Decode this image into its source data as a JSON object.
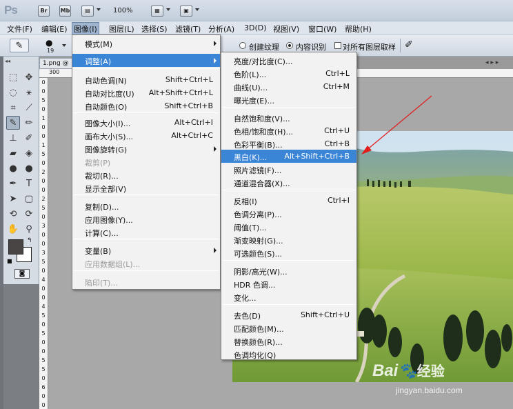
{
  "titlebar": {
    "logo": "Ps",
    "btn_br": "Br",
    "btn_mb": "Mb",
    "zoom": "100%"
  },
  "menubar": [
    "文件(F)",
    "编辑(E)",
    "图像(I)",
    "图层(L)",
    "选择(S)",
    "滤镜(T)",
    "分析(A)",
    "3D(D)",
    "视图(V)",
    "窗口(W)",
    "帮助(H)"
  ],
  "options": {
    "brush_size": "19",
    "create_texture": "创建纹理",
    "content_aware": "内容识别",
    "sample_all_layers": "对所有图层取样"
  },
  "document": {
    "tab_label": "1.png @"
  },
  "ruler": {
    "h_first": "300",
    "v_marks": [
      "0",
      "0",
      "5",
      "0",
      "1",
      "0",
      "0",
      "1",
      "5",
      "0",
      "2",
      "0",
      "0",
      "2",
      "5",
      "0",
      "3",
      "0",
      "0",
      "3",
      "5",
      "0",
      "4",
      "0",
      "0",
      "4",
      "5",
      "0",
      "5",
      "0",
      "0",
      "5",
      "5",
      "0",
      "6",
      "0",
      "0"
    ]
  },
  "image_menu": {
    "items": [
      {
        "label": "模式(M)",
        "shortcut": "",
        "submenu": true,
        "disabled": false,
        "highlight": false
      },
      {
        "label": "调整(A)",
        "shortcut": "",
        "submenu": true,
        "disabled": false,
        "highlight": true
      },
      {
        "label": "自动色调(N)",
        "shortcut": "Shift+Ctrl+L",
        "submenu": false,
        "disabled": false,
        "highlight": false
      },
      {
        "label": "自动对比度(U)",
        "shortcut": "Alt+Shift+Ctrl+L",
        "submenu": false,
        "disabled": false,
        "highlight": false
      },
      {
        "label": "自动颜色(O)",
        "shortcut": "Shift+Ctrl+B",
        "submenu": false,
        "disabled": false,
        "highlight": false
      },
      {
        "label": "图像大小(I)...",
        "shortcut": "Alt+Ctrl+I",
        "submenu": false,
        "disabled": false,
        "highlight": false
      },
      {
        "label": "画布大小(S)...",
        "shortcut": "Alt+Ctrl+C",
        "submenu": false,
        "disabled": false,
        "highlight": false
      },
      {
        "label": "图像旋转(G)",
        "shortcut": "",
        "submenu": true,
        "disabled": false,
        "highlight": false
      },
      {
        "label": "裁剪(P)",
        "shortcut": "",
        "submenu": false,
        "disabled": true,
        "highlight": false
      },
      {
        "label": "裁切(R)...",
        "shortcut": "",
        "submenu": false,
        "disabled": false,
        "highlight": false
      },
      {
        "label": "显示全部(V)",
        "shortcut": "",
        "submenu": false,
        "disabled": false,
        "highlight": false
      },
      {
        "label": "复制(D)...",
        "shortcut": "",
        "submenu": false,
        "disabled": false,
        "highlight": false
      },
      {
        "label": "应用图像(Y)...",
        "shortcut": "",
        "submenu": false,
        "disabled": false,
        "highlight": false
      },
      {
        "label": "计算(C)...",
        "shortcut": "",
        "submenu": false,
        "disabled": false,
        "highlight": false
      },
      {
        "label": "变量(B)",
        "shortcut": "",
        "submenu": true,
        "disabled": false,
        "highlight": false
      },
      {
        "label": "应用数据组(L)...",
        "shortcut": "",
        "submenu": false,
        "disabled": true,
        "highlight": false
      },
      {
        "label": "陷印(T)...",
        "shortcut": "",
        "submenu": false,
        "disabled": true,
        "highlight": false
      }
    ]
  },
  "adjust_menu": {
    "items": [
      {
        "label": "亮度/对比度(C)...",
        "shortcut": "",
        "highlight": false
      },
      {
        "label": "色阶(L)...",
        "shortcut": "Ctrl+L",
        "highlight": false
      },
      {
        "label": "曲线(U)...",
        "shortcut": "Ctrl+M",
        "highlight": false
      },
      {
        "label": "曝光度(E)...",
        "shortcut": "",
        "highlight": false
      },
      {
        "label": "自然饱和度(V)...",
        "shortcut": "",
        "highlight": false
      },
      {
        "label": "色相/饱和度(H)...",
        "shortcut": "Ctrl+U",
        "highlight": false
      },
      {
        "label": "色彩平衡(B)...",
        "shortcut": "Ctrl+B",
        "highlight": false
      },
      {
        "label": "黑白(K)...",
        "shortcut": "Alt+Shift+Ctrl+B",
        "highlight": true
      },
      {
        "label": "照片滤镜(F)...",
        "shortcut": "",
        "highlight": false
      },
      {
        "label": "通道混合器(X)...",
        "shortcut": "",
        "highlight": false
      },
      {
        "label": "反相(I)",
        "shortcut": "Ctrl+I",
        "highlight": false
      },
      {
        "label": "色调分离(P)...",
        "shortcut": "",
        "highlight": false
      },
      {
        "label": "阈值(T)...",
        "shortcut": "",
        "highlight": false
      },
      {
        "label": "渐变映射(G)...",
        "shortcut": "",
        "highlight": false
      },
      {
        "label": "可选颜色(S)...",
        "shortcut": "",
        "highlight": false
      },
      {
        "label": "阴影/高光(W)...",
        "shortcut": "",
        "highlight": false
      },
      {
        "label": "HDR 色调...",
        "shortcut": "",
        "highlight": false
      },
      {
        "label": "变化...",
        "shortcut": "",
        "highlight": false
      },
      {
        "label": "去色(D)",
        "shortcut": "Shift+Ctrl+U",
        "highlight": false
      },
      {
        "label": "匹配颜色(M)...",
        "shortcut": "",
        "highlight": false
      },
      {
        "label": "替换颜色(R)...",
        "shortcut": "",
        "highlight": false
      },
      {
        "label": "色调均化(Q)",
        "shortcut": "",
        "highlight": false
      }
    ]
  },
  "watermark": {
    "brand_a": "Bai",
    "brand_b": "经验",
    "url": "jingyan.baidu.com"
  },
  "colors": {
    "menu_highlight": "#3a85d6",
    "arrow": "#e21b1b"
  }
}
